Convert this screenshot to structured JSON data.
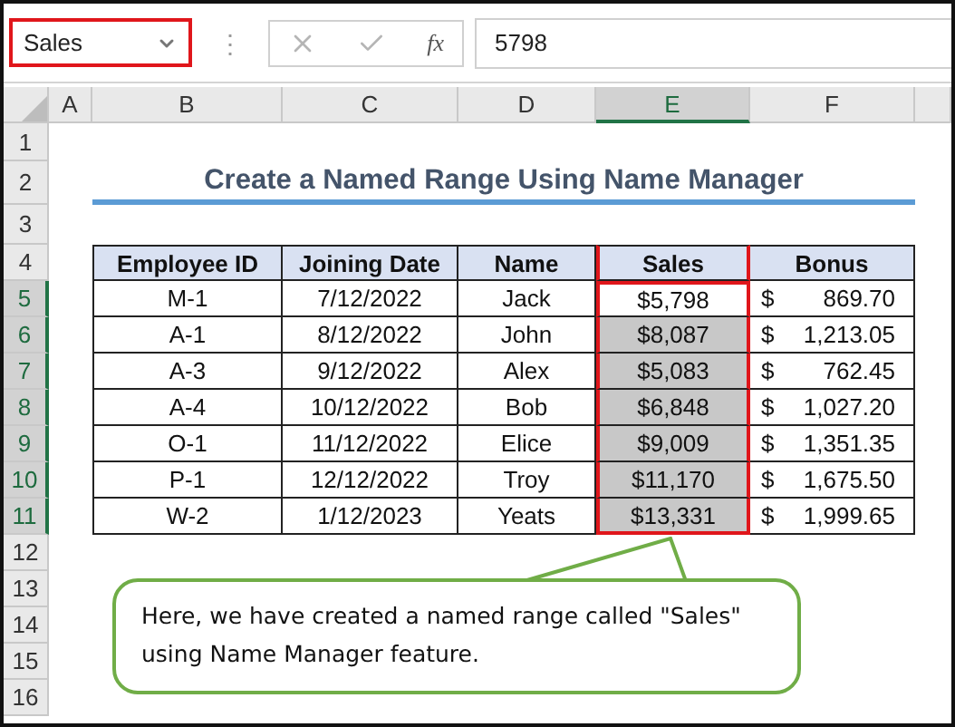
{
  "formula_bar": {
    "name_box": "Sales",
    "separator": "⋮",
    "formula_icon": "fx",
    "value": "5798"
  },
  "columns": [
    {
      "label": "A",
      "selected": false
    },
    {
      "label": "B",
      "selected": false
    },
    {
      "label": "C",
      "selected": false
    },
    {
      "label": "D",
      "selected": false
    },
    {
      "label": "E",
      "selected": true
    },
    {
      "label": "F",
      "selected": false
    }
  ],
  "row_headers": [
    {
      "label": "1",
      "selected": false
    },
    {
      "label": "2",
      "selected": false
    },
    {
      "label": "3",
      "selected": false
    },
    {
      "label": "4",
      "selected": false
    },
    {
      "label": "5",
      "selected": true
    },
    {
      "label": "6",
      "selected": true
    },
    {
      "label": "7",
      "selected": true
    },
    {
      "label": "8",
      "selected": true
    },
    {
      "label": "9",
      "selected": true
    },
    {
      "label": "10",
      "selected": true
    },
    {
      "label": "11",
      "selected": true
    },
    {
      "label": "12",
      "selected": false
    },
    {
      "label": "13",
      "selected": false
    },
    {
      "label": "14",
      "selected": false
    },
    {
      "label": "15",
      "selected": false
    },
    {
      "label": "16",
      "selected": false
    }
  ],
  "title": "Create a Named Range Using Name Manager",
  "table": {
    "columns": [
      "Employee ID",
      "Joining Date",
      "Name",
      "Sales",
      "Bonus"
    ],
    "rows": [
      {
        "id": "M-1",
        "date": "7/12/2022",
        "name": "Jack",
        "sales": "$5,798",
        "sales_shaded": false,
        "bonus_currency": "$",
        "bonus": "869.70"
      },
      {
        "id": "A-1",
        "date": "8/12/2022",
        "name": "John",
        "sales": "$8,087",
        "sales_shaded": true,
        "bonus_currency": "$",
        "bonus": "1,213.05"
      },
      {
        "id": "A-3",
        "date": "9/12/2022",
        "name": "Alex",
        "sales": "$5,083",
        "sales_shaded": true,
        "bonus_currency": "$",
        "bonus": "762.45"
      },
      {
        "id": "A-4",
        "date": "10/12/2022",
        "name": "Bob",
        "sales": "$6,848",
        "sales_shaded": true,
        "bonus_currency": "$",
        "bonus": "1,027.20"
      },
      {
        "id": "O-1",
        "date": "11/12/2022",
        "name": "Elice",
        "sales": "$9,009",
        "sales_shaded": true,
        "bonus_currency": "$",
        "bonus": "1,351.35"
      },
      {
        "id": "P-1",
        "date": "12/12/2022",
        "name": "Troy",
        "sales": "$11,170",
        "sales_shaded": true,
        "bonus_currency": "$",
        "bonus": "1,675.50"
      },
      {
        "id": "W-2",
        "date": "1/12/2023",
        "name": "Yeats",
        "sales": "$13,331",
        "sales_shaded": true,
        "bonus_currency": "$",
        "bonus": "1,999.65"
      }
    ]
  },
  "callout": {
    "text": "Here, we have created a named range called \"Sales\" using Name Manager feature."
  }
}
